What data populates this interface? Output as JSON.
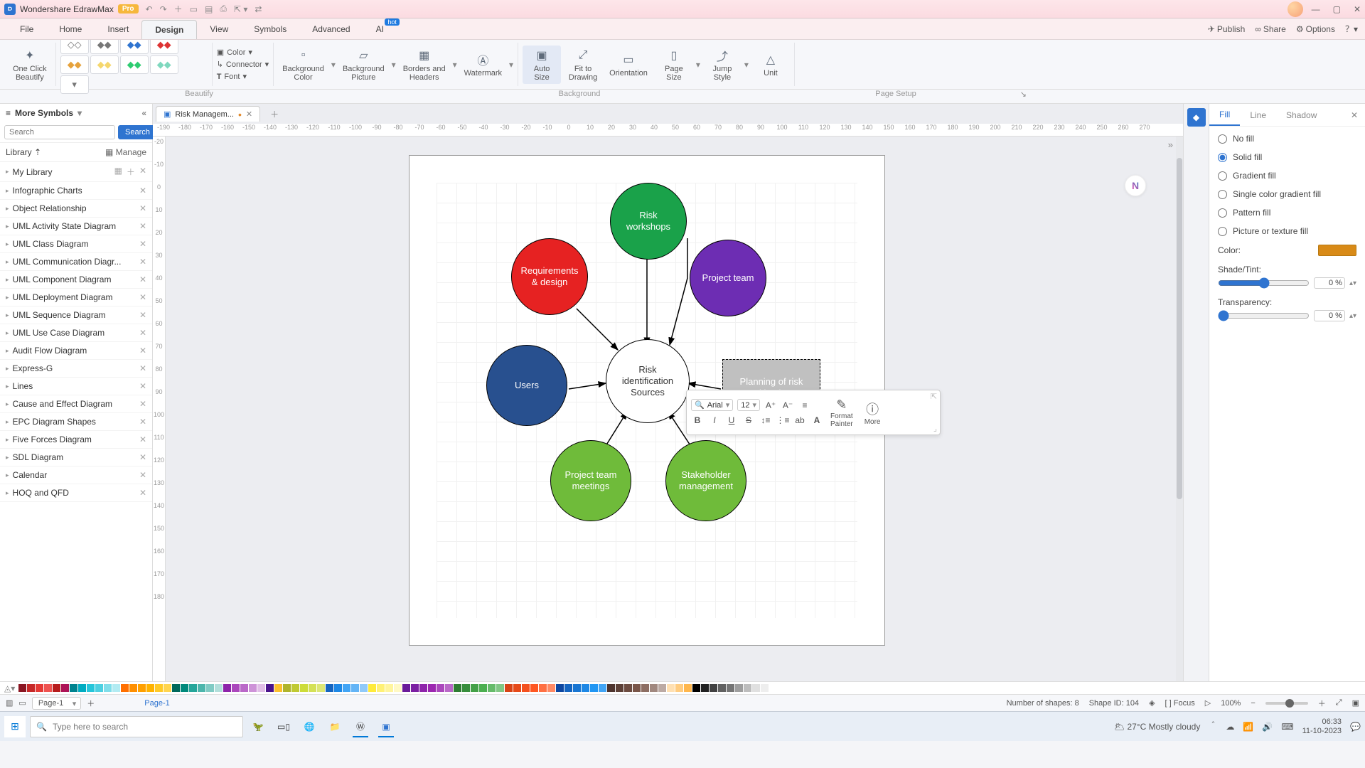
{
  "app": {
    "title": "Wondershare EdrawMax",
    "badge": "Pro"
  },
  "menu": {
    "items": [
      "File",
      "Home",
      "Insert",
      "Design",
      "View",
      "Symbols",
      "Advanced",
      "AI"
    ],
    "active": "Design",
    "ai_hot": "hot",
    "right": {
      "publish": "Publish",
      "share": "Share",
      "options": "Options"
    }
  },
  "ribbon": {
    "one_click": "One Click\nBeautify",
    "color": "Color",
    "connector": "Connector",
    "font": "Font",
    "bg_color": "Background\nColor",
    "bg_picture": "Background\nPicture",
    "borders": "Borders and\nHeaders",
    "watermark": "Watermark",
    "auto_size": "Auto\nSize",
    "fit": "Fit to\nDrawing",
    "orientation": "Orientation",
    "page_size": "Page\nSize",
    "jump_style": "Jump\nStyle",
    "unit": "Unit",
    "groups": {
      "beautify": "Beautify",
      "background": "Background",
      "page_setup": "Page Setup"
    }
  },
  "left": {
    "header": "More Symbols",
    "search_placeholder": "Search",
    "search_btn": "Search",
    "library": "Library",
    "manage": "Manage",
    "mylib": "My Library",
    "items": [
      "Infographic Charts",
      "Object Relationship",
      "UML Activity State Diagram",
      "UML Class Diagram",
      "UML Communication Diagr...",
      "UML Component Diagram",
      "UML Deployment Diagram",
      "UML Sequence Diagram",
      "UML Use Case Diagram",
      "Audit Flow Diagram",
      "Express-G",
      "Lines",
      "Cause and Effect Diagram",
      "EPC Diagram Shapes",
      "Five Forces Diagram",
      "SDL Diagram",
      "Calendar",
      "HOQ and QFD"
    ]
  },
  "doc": {
    "tab": "Risk Managem..."
  },
  "nodes": {
    "center": "Risk\nidentification\nSources",
    "top": "Risk\nworkshops",
    "tl": "Requirements\n& design",
    "tr": "Project team",
    "l": "Users",
    "bl": "Project team\nmeetings",
    "br": "Stakeholder\nmanagement",
    "r": "Planning of risk\nmitigation\nstrategies"
  },
  "float": {
    "font": "Arial",
    "size": "12",
    "format_painter": "Format\nPainter",
    "more": "More"
  },
  "right": {
    "tabs": {
      "fill": "Fill",
      "line": "Line",
      "shadow": "Shadow"
    },
    "opts": {
      "none": "No fill",
      "solid": "Solid fill",
      "grad": "Gradient fill",
      "single": "Single color gradient fill",
      "pattern": "Pattern fill",
      "pic": "Picture or texture fill"
    },
    "color": "Color:",
    "shade": "Shade/Tint:",
    "trans": "Transparency:",
    "pct": "0 %"
  },
  "palette_colors": [
    "#8a1522",
    "#c62828",
    "#e53935",
    "#ef5350",
    "#b71c1c",
    "#ad1457",
    "#00838f",
    "#00acc1",
    "#26c6da",
    "#4dd0e1",
    "#80deea",
    "#b2ebf2",
    "#ff6f00",
    "#ff8f00",
    "#ffa000",
    "#ffb300",
    "#ffca28",
    "#ffd54f",
    "#00695c",
    "#00897b",
    "#26a69a",
    "#4db6ac",
    "#80cbc4",
    "#b2dfdb",
    "#8e24aa",
    "#ab47bc",
    "#ba68c8",
    "#ce93d8",
    "#e1bee7",
    "#4a148c",
    "#fbc02d",
    "#afb42b",
    "#c0ca33",
    "#cddc39",
    "#d4e157",
    "#dce775",
    "#1565c0",
    "#1e88e5",
    "#42a5f5",
    "#64b5f6",
    "#90caf9",
    "#ffeb3b",
    "#fff176",
    "#fff59d",
    "#fff9c4",
    "#6a1b9a",
    "#7b1fa2",
    "#8e24aa",
    "#9c27b0",
    "#ab47bc",
    "#ba68c8",
    "#2e7d32",
    "#388e3c",
    "#43a047",
    "#4caf50",
    "#66bb6a",
    "#81c784",
    "#d84315",
    "#e64a19",
    "#f4511e",
    "#ff5722",
    "#ff7043",
    "#ff8a65",
    "#0d47a1",
    "#1565c0",
    "#1976d2",
    "#1e88e5",
    "#2196f3",
    "#42a5f5",
    "#4e342e",
    "#5d4037",
    "#6d4c41",
    "#795548",
    "#8d6e63",
    "#a1887f",
    "#bcaaa4",
    "#ffe0b2",
    "#ffcc80",
    "#ffb74d",
    "#000000",
    "#212121",
    "#424242",
    "#616161",
    "#757575",
    "#9e9e9e",
    "#bdbdbd",
    "#e0e0e0",
    "#eeeeee",
    "#ffffff"
  ],
  "status": {
    "page_sel": "Page-1",
    "page_tab": "Page-1",
    "shapes": "Number of shapes: 8",
    "shape_id": "Shape ID: 104",
    "focus": "Focus",
    "zoom": "100%"
  },
  "taskbar": {
    "search": "Type here to search",
    "temp": "27°C",
    "weather": "Mostly cloudy",
    "time": "06:33",
    "date": "11-10-2023"
  },
  "ruler_h": [
    "-190",
    "-180",
    "-170",
    "-160",
    "-150",
    "-140",
    "-130",
    "-120",
    "-110",
    "-100",
    "-90",
    "-80",
    "-70",
    "-60",
    "-50",
    "-40",
    "-30",
    "-20",
    "-10",
    "0",
    "10",
    "20",
    "30",
    "40",
    "50",
    "60",
    "70",
    "80",
    "90",
    "100",
    "110",
    "120",
    "130",
    "140",
    "150",
    "160",
    "170",
    "180",
    "190",
    "200",
    "210",
    "220",
    "230",
    "240",
    "250",
    "260",
    "270"
  ],
  "ruler_v": [
    "-20",
    "-10",
    "0",
    "10",
    "20",
    "30",
    "40",
    "50",
    "60",
    "70",
    "80",
    "90",
    "100",
    "110",
    "120",
    "130",
    "140",
    "150",
    "160",
    "170",
    "180"
  ]
}
